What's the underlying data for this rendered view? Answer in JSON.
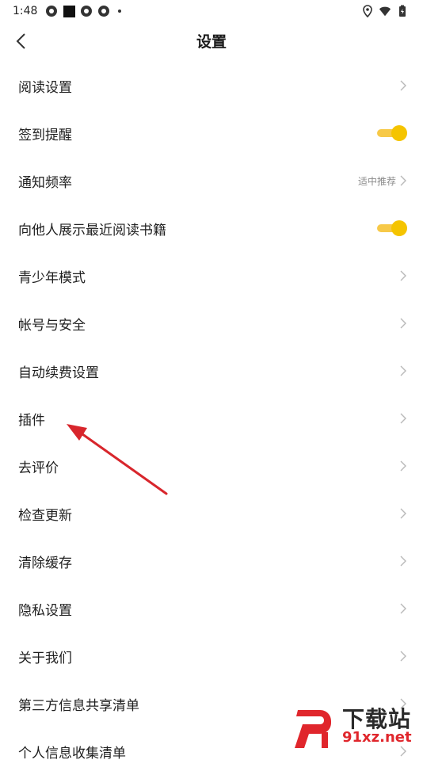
{
  "status_bar": {
    "time": "1:48"
  },
  "header": {
    "title": "设置"
  },
  "settings": [
    {
      "label": "阅读设置",
      "control": "chevron"
    },
    {
      "label": "签到提醒",
      "control": "toggle",
      "on": true
    },
    {
      "label": "通知频率",
      "control": "chevron",
      "value": "适中推荐"
    },
    {
      "label": "向他人展示最近阅读书籍",
      "control": "toggle",
      "on": true
    },
    {
      "label": "青少年模式",
      "control": "chevron"
    },
    {
      "label": "帐号与安全",
      "control": "chevron"
    },
    {
      "label": "自动续费设置",
      "control": "chevron"
    },
    {
      "label": "插件",
      "control": "chevron"
    },
    {
      "label": "去评价",
      "control": "chevron"
    },
    {
      "label": "检查更新",
      "control": "chevron"
    },
    {
      "label": "清除缓存",
      "control": "chevron"
    },
    {
      "label": "隐私设置",
      "control": "chevron"
    },
    {
      "label": "关于我们",
      "control": "chevron"
    },
    {
      "label": "第三方信息共享清单",
      "control": "chevron"
    },
    {
      "label": "个人信息收集清单",
      "control": "chevron"
    }
  ],
  "watermark": {
    "title": "下载站",
    "url": "91xz.net"
  },
  "colors": {
    "toggle_on": "#f5c400",
    "annotation": "#d8262c",
    "chevron": "#b9b9b9"
  }
}
